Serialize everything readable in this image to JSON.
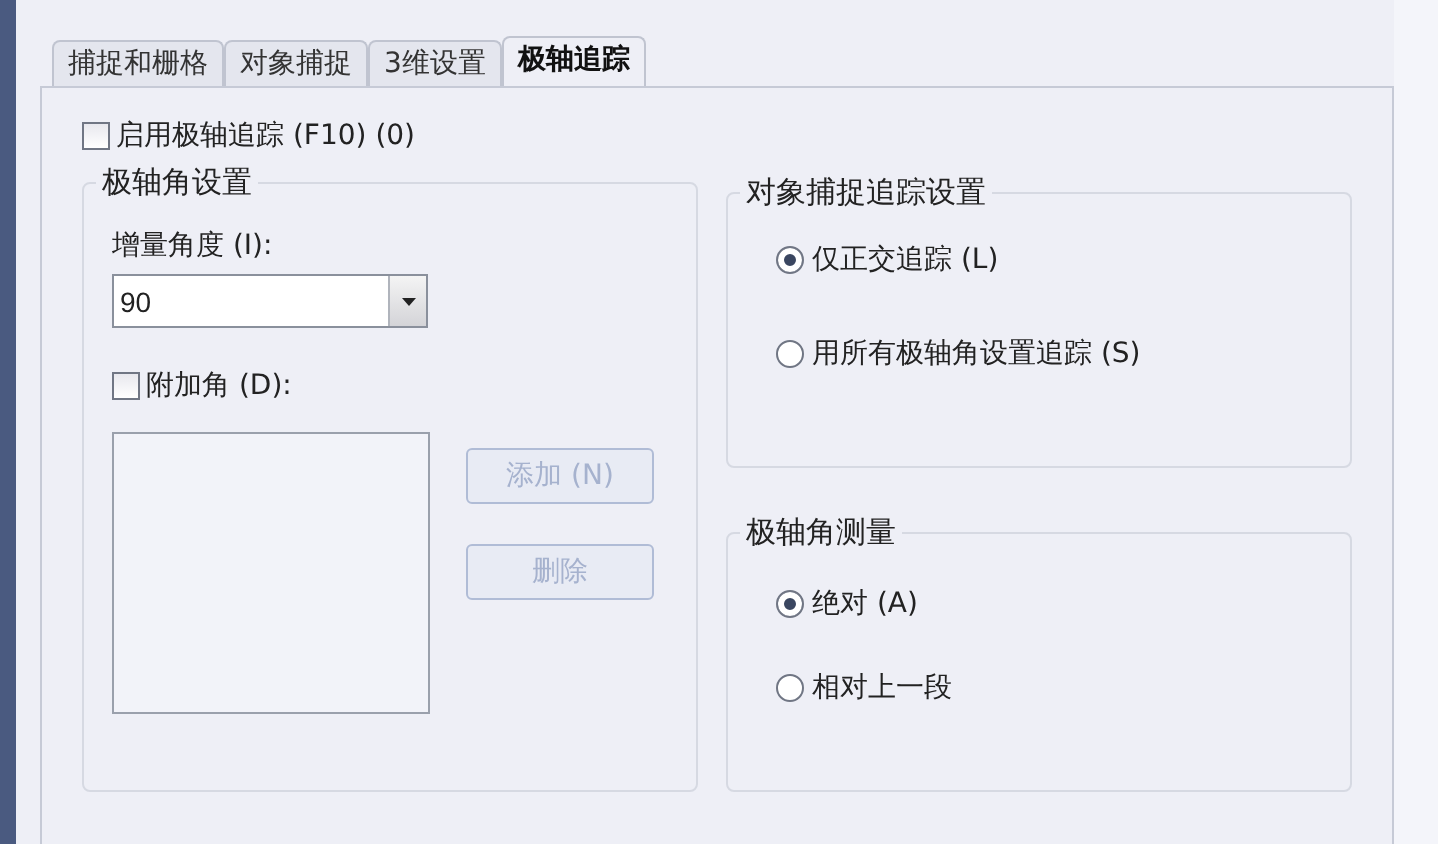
{
  "tabs": [
    {
      "label": "捕捉和栅格",
      "selected": false
    },
    {
      "label": "对象捕捉",
      "selected": false
    },
    {
      "label": "3维设置",
      "selected": false
    },
    {
      "label": "极轴追踪",
      "selected": true
    }
  ],
  "enable_polar_tracking": {
    "label": "启用极轴追踪 (F10) (0)",
    "checked": false
  },
  "polar_angle_settings": {
    "title": "极轴角设置",
    "increment_label": "增量角度 (I):",
    "increment_value": "90",
    "additional_angles": {
      "label": "附加角 (D):",
      "checked": false
    },
    "buttons": [
      {
        "label": "添加 (N)",
        "disabled": true
      },
      {
        "label": "删除",
        "disabled": true
      }
    ]
  },
  "object_snap_tracking": {
    "title": "对象捕捉追踪设置",
    "options": [
      {
        "label": "仅正交追踪 (L)",
        "selected": true
      },
      {
        "label": "用所有极轴角设置追踪 (S)",
        "selected": false
      }
    ]
  },
  "polar_angle_measurement": {
    "title": "极轴角测量",
    "options": [
      {
        "label": "绝对 (A)",
        "selected": true
      },
      {
        "label": "相对上一段",
        "selected": false
      }
    ]
  }
}
